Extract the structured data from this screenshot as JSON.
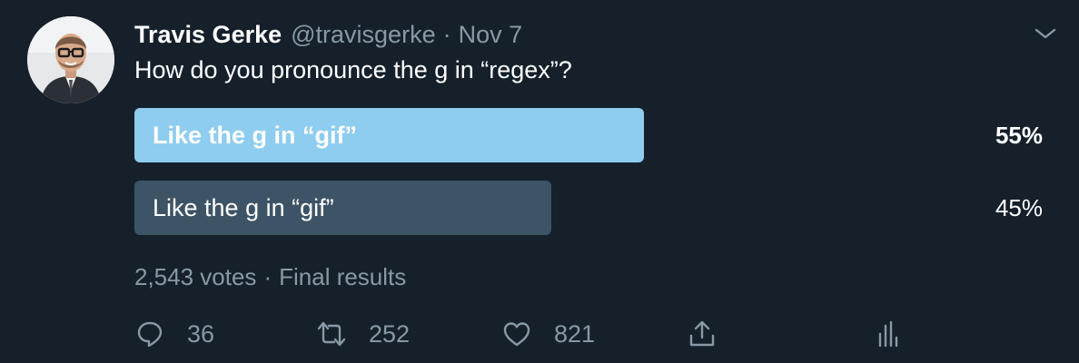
{
  "tweet": {
    "author_name": "Travis Gerke",
    "handle": "@travisgerke",
    "separator": "·",
    "date": "Nov 7",
    "text": "How do you pronounce the g in “regex”?"
  },
  "poll": {
    "options": [
      {
        "label": "Like the g in “gif”",
        "percent_label": "55%",
        "share": 0.55,
        "leading": true
      },
      {
        "label": "Like the g in “gif”",
        "percent_label": "45%",
        "share": 0.45,
        "leading": false
      }
    ],
    "votes": "2,543 votes",
    "separator": "·",
    "status": "Final results"
  },
  "actions": {
    "replies": "36",
    "retweets": "252",
    "likes": "821"
  },
  "colors": {
    "background": "#15202b",
    "leading_bar": "#8ecdf0",
    "other_bar": "#3d5466",
    "secondary_text": "#8899a6"
  },
  "icons": {
    "avatar": "profile-photo",
    "caret": "chevron-down-icon",
    "reply": "reply-icon",
    "retweet": "retweet-icon",
    "like": "heart-icon",
    "share": "share-icon",
    "analytics": "analytics-icon"
  }
}
